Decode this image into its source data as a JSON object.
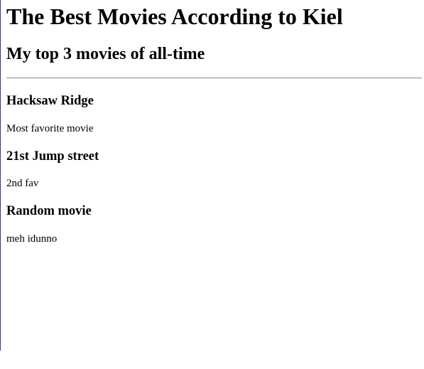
{
  "page": {
    "title": "The Best Movies According to Kiel",
    "subtitle": "My top 3 movies of all-time"
  },
  "movies": [
    {
      "title": "Hacksaw Ridge",
      "description": "Most favorite movie"
    },
    {
      "title": "21st Jump street",
      "description": "2nd fav"
    },
    {
      "title": "Random movie",
      "description": "meh idunno"
    }
  ]
}
